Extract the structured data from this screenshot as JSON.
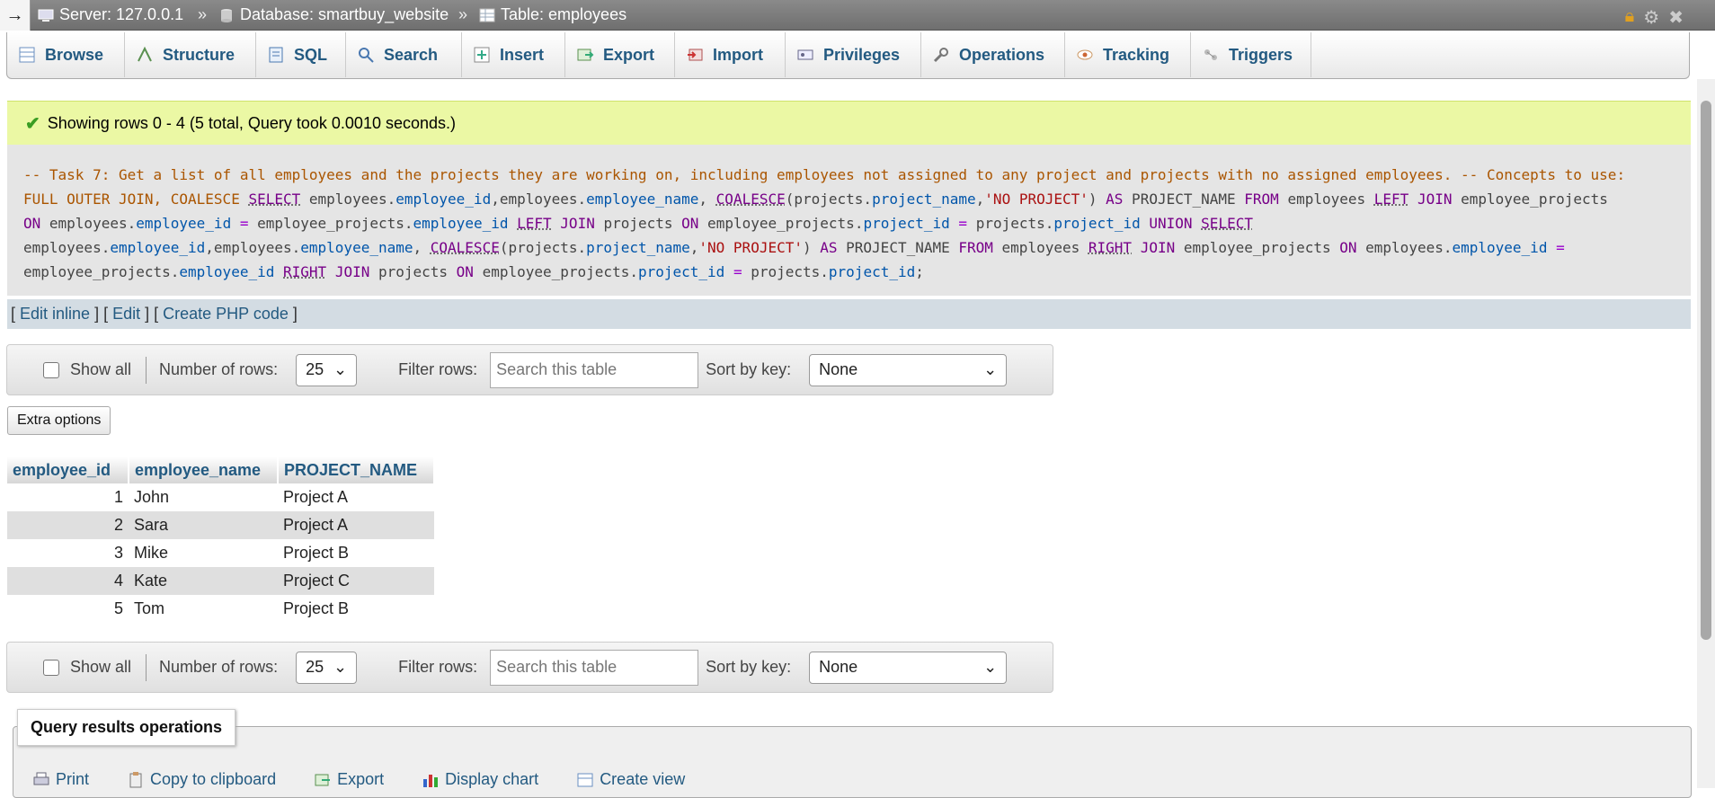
{
  "breadcrumb": {
    "collapse_glyph": "→",
    "server": "Server: 127.0.0.1",
    "database": "Database: smartbuy_website",
    "table": "Table: employees",
    "separator": "»"
  },
  "tabs": [
    {
      "label": "Browse",
      "icon": "browse-icon"
    },
    {
      "label": "Structure",
      "icon": "structure-icon"
    },
    {
      "label": "SQL",
      "icon": "sql-icon"
    },
    {
      "label": "Search",
      "icon": "search-icon"
    },
    {
      "label": "Insert",
      "icon": "insert-icon"
    },
    {
      "label": "Export",
      "icon": "export-icon"
    },
    {
      "label": "Import",
      "icon": "import-icon"
    },
    {
      "label": "Privileges",
      "icon": "privileges-icon"
    },
    {
      "label": "Operations",
      "icon": "operations-icon"
    },
    {
      "label": "Tracking",
      "icon": "tracking-icon"
    },
    {
      "label": "Triggers",
      "icon": "triggers-icon"
    }
  ],
  "success_message": "Showing rows 0 - 4 (5 total, Query took 0.0010 seconds.)",
  "sql": {
    "comment": "-- Task 7: Get a list of all employees and the projects they are working on, including employees not assigned to any project and projects with no assigned employees. -- Concepts to use:",
    "comment2": "FULL OUTER JOIN, COALESCE"
  },
  "sql_links": {
    "edit_inline": "Edit inline",
    "edit": "Edit",
    "create_php": "Create PHP code"
  },
  "nav": {
    "show_all": "Show all",
    "num_rows_label": "Number of rows:",
    "num_rows_value": "25",
    "filter_label": "Filter rows:",
    "filter_placeholder": "Search this table",
    "sort_label": "Sort by key:",
    "sort_value": "None"
  },
  "extra_options": "Extra options",
  "table": {
    "columns": [
      "employee_id",
      "employee_name",
      "PROJECT_NAME"
    ],
    "rows": [
      {
        "id": "1",
        "name": "John",
        "project": "Project A"
      },
      {
        "id": "2",
        "name": "Sara",
        "project": "Project A"
      },
      {
        "id": "3",
        "name": "Mike",
        "project": "Project B"
      },
      {
        "id": "4",
        "name": "Kate",
        "project": "Project C"
      },
      {
        "id": "5",
        "name": "Tom",
        "project": "Project B"
      }
    ]
  },
  "query_ops": {
    "title": "Query results operations",
    "print": "Print",
    "copy": "Copy to clipboard",
    "export": "Export",
    "chart": "Display chart",
    "view": "Create view"
  }
}
